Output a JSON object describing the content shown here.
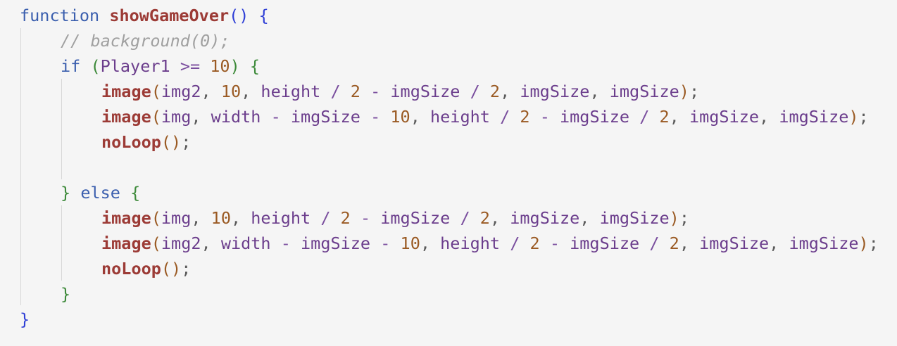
{
  "code": {
    "lines": [
      {
        "indent": 0,
        "tokens": [
          {
            "t": "function",
            "c": "kw"
          },
          {
            "t": " "
          },
          {
            "t": "showGameOver",
            "c": "fn-def"
          },
          {
            "t": "()",
            "c": "b0"
          },
          {
            "t": " "
          },
          {
            "t": "{",
            "c": "b0"
          }
        ]
      },
      {
        "indent": 1,
        "tokens": [
          {
            "t": "// background(0);",
            "c": "comment"
          }
        ]
      },
      {
        "indent": 1,
        "tokens": [
          {
            "t": "if",
            "c": "kw"
          },
          {
            "t": " "
          },
          {
            "t": "(",
            "c": "b1"
          },
          {
            "t": "Player1",
            "c": "var"
          },
          {
            "t": " "
          },
          {
            "t": ">=",
            "c": "op"
          },
          {
            "t": " "
          },
          {
            "t": "10",
            "c": "num"
          },
          {
            "t": ")",
            "c": "b1"
          },
          {
            "t": " "
          },
          {
            "t": "{",
            "c": "b1"
          }
        ]
      },
      {
        "indent": 2,
        "tokens": [
          {
            "t": "image",
            "c": "fn"
          },
          {
            "t": "(",
            "c": "b2"
          },
          {
            "t": "img2",
            "c": "var"
          },
          {
            "t": ",",
            "c": "punct"
          },
          {
            "t": " "
          },
          {
            "t": "10",
            "c": "num"
          },
          {
            "t": ",",
            "c": "punct"
          },
          {
            "t": " "
          },
          {
            "t": "height",
            "c": "var"
          },
          {
            "t": " "
          },
          {
            "t": "/",
            "c": "op"
          },
          {
            "t": " "
          },
          {
            "t": "2",
            "c": "num"
          },
          {
            "t": " "
          },
          {
            "t": "-",
            "c": "op"
          },
          {
            "t": " "
          },
          {
            "t": "imgSize",
            "c": "var"
          },
          {
            "t": " "
          },
          {
            "t": "/",
            "c": "op"
          },
          {
            "t": " "
          },
          {
            "t": "2",
            "c": "num"
          },
          {
            "t": ",",
            "c": "punct"
          },
          {
            "t": " "
          },
          {
            "t": "imgSize",
            "c": "var"
          },
          {
            "t": ",",
            "c": "punct"
          },
          {
            "t": " "
          },
          {
            "t": "imgSize",
            "c": "var"
          },
          {
            "t": ")",
            "c": "b2"
          },
          {
            "t": ";",
            "c": "punct"
          }
        ]
      },
      {
        "indent": 2,
        "tokens": [
          {
            "t": "image",
            "c": "fn"
          },
          {
            "t": "(",
            "c": "b2"
          },
          {
            "t": "img",
            "c": "var"
          },
          {
            "t": ",",
            "c": "punct"
          },
          {
            "t": " "
          },
          {
            "t": "width",
            "c": "var"
          },
          {
            "t": " "
          },
          {
            "t": "-",
            "c": "op"
          },
          {
            "t": " "
          },
          {
            "t": "imgSize",
            "c": "var"
          },
          {
            "t": " "
          },
          {
            "t": "-",
            "c": "op"
          },
          {
            "t": " "
          },
          {
            "t": "10",
            "c": "num"
          },
          {
            "t": ",",
            "c": "punct"
          },
          {
            "t": " "
          },
          {
            "t": "height",
            "c": "var"
          },
          {
            "t": " "
          },
          {
            "t": "/",
            "c": "op"
          },
          {
            "t": " "
          },
          {
            "t": "2",
            "c": "num"
          },
          {
            "t": " "
          },
          {
            "t": "-",
            "c": "op"
          },
          {
            "t": " "
          },
          {
            "t": "imgSize",
            "c": "var"
          },
          {
            "t": " "
          },
          {
            "t": "/",
            "c": "op"
          },
          {
            "t": " "
          },
          {
            "t": "2",
            "c": "num"
          },
          {
            "t": ",",
            "c": "punct"
          },
          {
            "t": " "
          },
          {
            "t": "imgSize",
            "c": "var"
          },
          {
            "t": ",",
            "c": "punct"
          },
          {
            "t": " "
          },
          {
            "t": "imgSize",
            "c": "var"
          },
          {
            "t": ")",
            "c": "b2"
          },
          {
            "t": ";",
            "c": "punct"
          }
        ]
      },
      {
        "indent": 2,
        "tokens": [
          {
            "t": "noLoop",
            "c": "fn"
          },
          {
            "t": "()",
            "c": "b2"
          },
          {
            "t": ";",
            "c": "punct"
          }
        ]
      },
      {
        "indent": 2,
        "tokens": []
      },
      {
        "indent": 1,
        "tokens": [
          {
            "t": "}",
            "c": "b1"
          },
          {
            "t": " "
          },
          {
            "t": "else",
            "c": "kw"
          },
          {
            "t": " "
          },
          {
            "t": "{",
            "c": "b1"
          }
        ]
      },
      {
        "indent": 2,
        "tokens": [
          {
            "t": "image",
            "c": "fn"
          },
          {
            "t": "(",
            "c": "b2"
          },
          {
            "t": "img",
            "c": "var"
          },
          {
            "t": ",",
            "c": "punct"
          },
          {
            "t": " "
          },
          {
            "t": "10",
            "c": "num"
          },
          {
            "t": ",",
            "c": "punct"
          },
          {
            "t": " "
          },
          {
            "t": "height",
            "c": "var"
          },
          {
            "t": " "
          },
          {
            "t": "/",
            "c": "op"
          },
          {
            "t": " "
          },
          {
            "t": "2",
            "c": "num"
          },
          {
            "t": " "
          },
          {
            "t": "-",
            "c": "op"
          },
          {
            "t": " "
          },
          {
            "t": "imgSize",
            "c": "var"
          },
          {
            "t": " "
          },
          {
            "t": "/",
            "c": "op"
          },
          {
            "t": " "
          },
          {
            "t": "2",
            "c": "num"
          },
          {
            "t": ",",
            "c": "punct"
          },
          {
            "t": " "
          },
          {
            "t": "imgSize",
            "c": "var"
          },
          {
            "t": ",",
            "c": "punct"
          },
          {
            "t": " "
          },
          {
            "t": "imgSize",
            "c": "var"
          },
          {
            "t": ")",
            "c": "b2"
          },
          {
            "t": ";",
            "c": "punct"
          }
        ]
      },
      {
        "indent": 2,
        "tokens": [
          {
            "t": "image",
            "c": "fn"
          },
          {
            "t": "(",
            "c": "b2"
          },
          {
            "t": "img2",
            "c": "var"
          },
          {
            "t": ",",
            "c": "punct"
          },
          {
            "t": " "
          },
          {
            "t": "width",
            "c": "var"
          },
          {
            "t": " "
          },
          {
            "t": "-",
            "c": "op"
          },
          {
            "t": " "
          },
          {
            "t": "imgSize",
            "c": "var"
          },
          {
            "t": " "
          },
          {
            "t": "-",
            "c": "op"
          },
          {
            "t": " "
          },
          {
            "t": "10",
            "c": "num"
          },
          {
            "t": ",",
            "c": "punct"
          },
          {
            "t": " "
          },
          {
            "t": "height",
            "c": "var"
          },
          {
            "t": " "
          },
          {
            "t": "/",
            "c": "op"
          },
          {
            "t": " "
          },
          {
            "t": "2",
            "c": "num"
          },
          {
            "t": " "
          },
          {
            "t": "-",
            "c": "op"
          },
          {
            "t": " "
          },
          {
            "t": "imgSize",
            "c": "var"
          },
          {
            "t": " "
          },
          {
            "t": "/",
            "c": "op"
          },
          {
            "t": " "
          },
          {
            "t": "2",
            "c": "num"
          },
          {
            "t": ",",
            "c": "punct"
          },
          {
            "t": " "
          },
          {
            "t": "imgSize",
            "c": "var"
          },
          {
            "t": ",",
            "c": "punct"
          },
          {
            "t": " "
          },
          {
            "t": "imgSize",
            "c": "var"
          },
          {
            "t": ")",
            "c": "b2"
          },
          {
            "t": ";",
            "c": "punct"
          }
        ]
      },
      {
        "indent": 2,
        "tokens": [
          {
            "t": "noLoop",
            "c": "fn"
          },
          {
            "t": "()",
            "c": "b2"
          },
          {
            "t": ";",
            "c": "punct"
          }
        ]
      },
      {
        "indent": 1,
        "tokens": [
          {
            "t": "}",
            "c": "b1"
          }
        ]
      },
      {
        "indent": 0,
        "tokens": [
          {
            "t": "}",
            "c": "b0"
          }
        ]
      }
    ]
  },
  "colors": {
    "background": "#f5f5f5",
    "keyword": "#3b5fae",
    "function": "#9c3b36",
    "variable": "#6b3d8c",
    "number": "#9a5a23",
    "comment": "#a0a0a0",
    "bracket_level_0": "#2f3fd6",
    "bracket_level_1": "#3d8a3a",
    "bracket_level_2": "#9a5a23"
  }
}
